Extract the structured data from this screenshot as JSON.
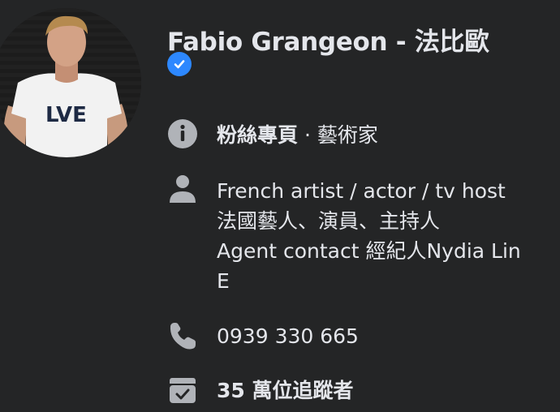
{
  "profile": {
    "name": "Fabio Grangeon - 法比歐",
    "verified_icon": "verified-badge-icon",
    "avatar_shirt_text": "LVE"
  },
  "info": {
    "category_type": "粉絲專頁",
    "category_separator": " · ",
    "category_value": "藝術家",
    "bio_line1": "French artist / actor / tv host",
    "bio_line2": "法國藝人、演員、主持人",
    "bio_line3": "Agent contact 經紀人Nydia Lin",
    "bio_line4": "E",
    "phone": "0939 330 665",
    "followers": "35 萬位追蹤者"
  },
  "icons": {
    "category": "info-icon",
    "bio": "person-icon",
    "phone": "phone-icon",
    "followers": "check-box-icon"
  },
  "colors": {
    "background": "#242526",
    "text": "#e4e6eb",
    "icon": "#b0b3b8",
    "accent": "#2d88ff"
  }
}
